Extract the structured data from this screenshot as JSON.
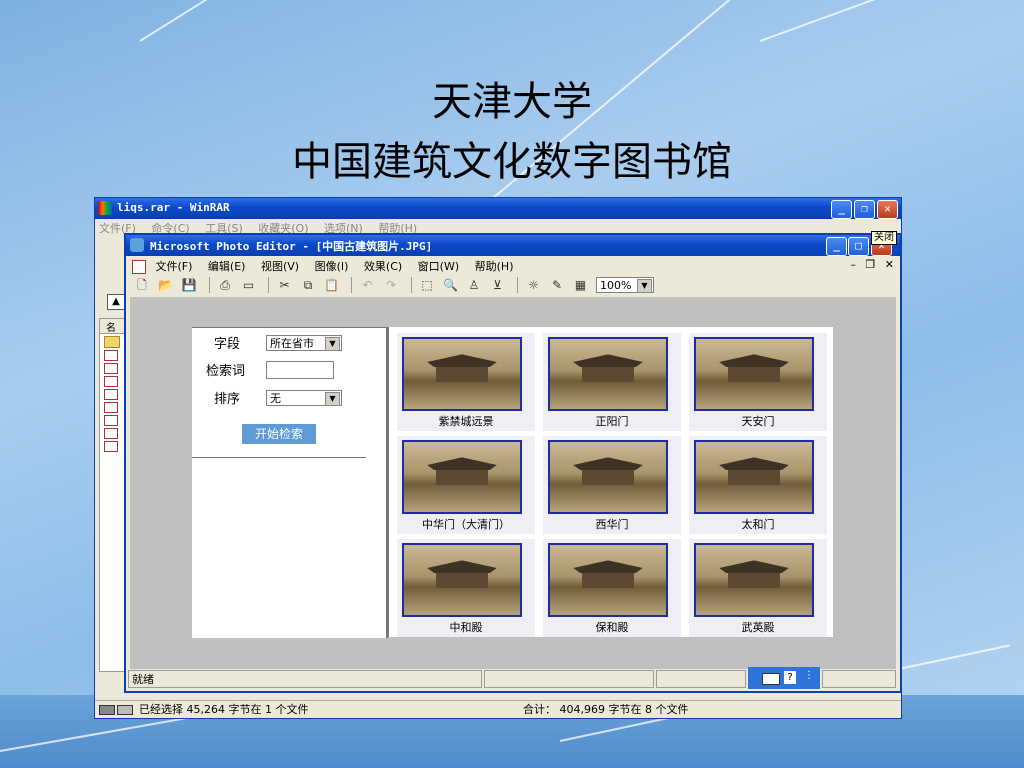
{
  "slide": {
    "title_line1": "天津大学",
    "title_line2": "中国建筑文化数字图书馆"
  },
  "winrar": {
    "title": "liqs.rar - WinRAR",
    "menu": [
      "文件(F)",
      "命令(C)",
      "工具(S)",
      "收藏夹(O)",
      "选项(N)",
      "帮助(H)"
    ],
    "list_header": "名",
    "statusbar_left": "已经选择 45,264 字节在 1 个文件",
    "statusbar_right": "合计： 404,969 字节在 8 个文件"
  },
  "photo_editor": {
    "title": "Microsoft Photo Editor - [中国古建筑图片.JPG]",
    "close_tooltip": "关闭",
    "menu": [
      "文件(F)",
      "编辑(E)",
      "视图(V)",
      "图像(I)",
      "效果(C)",
      "窗口(W)",
      "帮助(H)"
    ],
    "zoom": "100%",
    "status_ready": "就绪"
  },
  "search_panel": {
    "field_label": "字段",
    "field_value": "所在省市",
    "keyword_label": "检索词",
    "keyword_value": "",
    "sort_label": "排序",
    "sort_value": "无",
    "search_button": "开始检索"
  },
  "gallery": [
    {
      "caption": "紫禁城远景"
    },
    {
      "caption": "正阳门"
    },
    {
      "caption": "天安门"
    },
    {
      "caption": "中华门（大清门）"
    },
    {
      "caption": "西华门"
    },
    {
      "caption": "太和门"
    },
    {
      "caption": "中和殿"
    },
    {
      "caption": "保和殿"
    },
    {
      "caption": "武英殿"
    }
  ],
  "colors": {
    "titlebar": "#0c49c8",
    "photo_border": "#1f2b9e",
    "search_button": "#5d9ad6"
  }
}
